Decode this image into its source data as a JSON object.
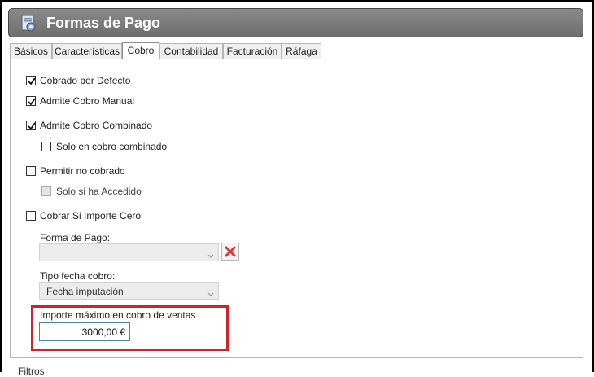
{
  "window": {
    "title": "Formas de Pago",
    "icon": "gear-document-icon"
  },
  "tabs": [
    {
      "label": "Básicos",
      "active": false
    },
    {
      "label": "Características",
      "active": false
    },
    {
      "label": "Cobro",
      "active": true
    },
    {
      "label": "Contabilidad",
      "active": false
    },
    {
      "label": "Facturación",
      "active": false
    },
    {
      "label": "Ráfaga",
      "active": false
    }
  ],
  "cobro": {
    "cobrado_por_defecto": {
      "label": "Cobrado por Defecto",
      "checked": true
    },
    "admite_cobro_manual": {
      "label": "Admite Cobro Manual",
      "checked": true
    },
    "admite_cobro_combinado": {
      "label": "Admite Cobro Combinado",
      "checked": true
    },
    "solo_en_cobro_combinado": {
      "label": "Solo en cobro combinado",
      "checked": false
    },
    "permitir_no_cobrado": {
      "label": "Permitir no cobrado",
      "checked": false
    },
    "solo_si_ha_accedido": {
      "label": "Solo si ha Accedido",
      "checked": false,
      "disabled": true
    },
    "cobrar_si_importe_cero": {
      "label": "Cobrar Si Importe Cero",
      "checked": false
    },
    "forma_de_pago": {
      "label": "Forma de Pago:",
      "value": ""
    },
    "tipo_fecha_cobro": {
      "label": "Tipo fecha cobro:",
      "value": "Fecha imputación"
    },
    "importe_maximo": {
      "label": "Importe máximo en cobro de ventas",
      "value": "3000,00 €"
    }
  },
  "footer": {
    "filtros_label": "Filtros"
  },
  "colors": {
    "highlight": "#d0232b",
    "titlebar": "#7a7a7a"
  }
}
